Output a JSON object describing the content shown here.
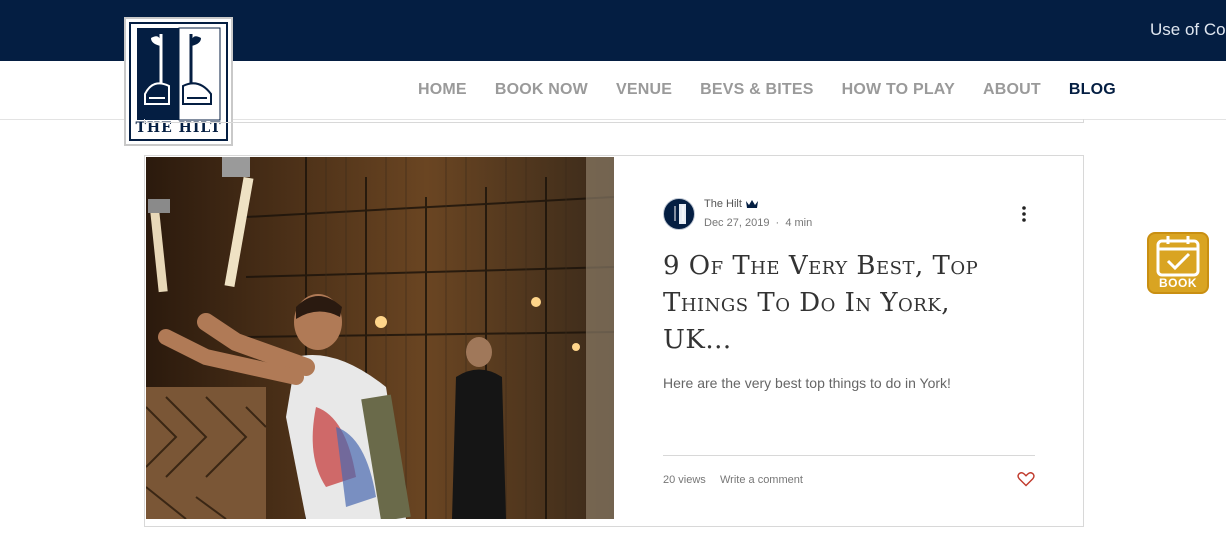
{
  "header": {
    "cookie_link": "Use of Coo",
    "logo_text": "THE HILT",
    "nav": [
      "HOME",
      "BOOK NOW",
      "VENUE",
      "BEVS & BITES",
      "HOW TO PLAY",
      "ABOUT",
      "BLOG"
    ],
    "active_nav": "BLOG"
  },
  "post": {
    "author": "The Hilt",
    "date": "Dec 27, 2019",
    "read_time": "4 min",
    "title": "9 Of The Very Best, Top Things To Do In York, UK...",
    "excerpt": "Here are the very best top things to do in York!",
    "views": "20 views",
    "comment_link": "Write a comment"
  },
  "widget": {
    "book_label": "BOOK"
  },
  "colors": {
    "navy": "#041e42",
    "nav_inactive": "#9a9a9a",
    "book_gold": "#d9a422",
    "like_red": "#c0392b"
  }
}
